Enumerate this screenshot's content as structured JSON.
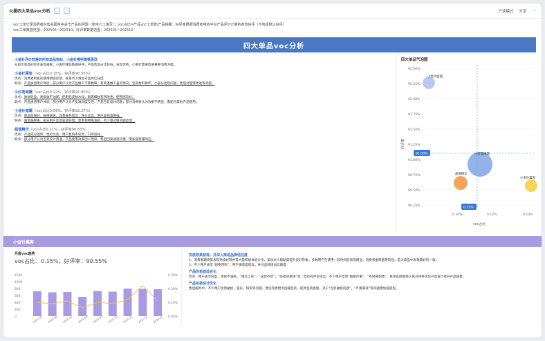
{
  "window": {
    "title": "火曼四大单品voc分析",
    "right_items": [
      "只读模式",
      "分享"
    ]
  },
  "meta": {
    "line1": "voc工单记录消费者在售后服务中关于产品的问题（使用人工填写）；voc占比=产品voc工单数/产品销量；好评率根据消费者电商平台产品评价计算的有效好评（不包括默认好评）",
    "line2": "voc工单数据范围：202505~202510；好评率数据范围：202501~202510"
  },
  "banner": {
    "title": "四大单品voc分析"
  },
  "left_text": {
    "heading": "小金针评价较差的所有单品指标，小金针哪些需要更改",
    "intro": "从四大单品的综合表现来看，小金针哪些数据好评，产品售后占比较低，表现优秀，小金针需要改进重要消费方面。",
    "products": [
      {
        "name": "小金针萬客",
        "stat": "（voc占比0.15%，好评率90.55%）",
        "pros_label": "优点：",
        "pros": "消费者积极的使用情感反馈，感受代入增加对品牌信任度",
        "cons_label": "缺点：",
        "cons": "产品质感用户体验，部分用户认为产品做工不够精细，有高温做工差的情况，包装材料易坏，小部分出现问题，售后处理需改进等问题。"
      },
      {
        "name": "小红笔眼霜",
        "stat": "（voc占比0.12%，好评率91.82%）",
        "pros_label": "优点：",
        "pros": "质地轻盈，易吸收不油腻，使用后皮肤水润，眼周细纹有所改善，使用感较好。",
        "cons_label": "缺点：",
        "cons": "产品质感用户体验，部分用户认为产品滋润度欠佳，产品包装设计问题，部分消费者认为效果不明显，需配合其他产品使用。"
      },
      {
        "name": "小金针面霜",
        "stat": "（voc占比0.09%，好评率92.27%）",
        "pros_label": "优点：",
        "pros": "保湿效果好，肤感清爽，改善肤色暗沉，性价比高，用户复购意愿强。",
        "cons_label": "缺点：",
        "cons": "质地偏厚重，部分用户反馈吸收较慢，夏季使用略油腻，有少量过敏问题反馈。"
      },
      {
        "name": "超值精华",
        "stat": "（voc占比0.11%，好评率90.83%）",
        "pros_label": "优点：",
        "pros": "产品成分温和，性价比高，用户复购率较高，口碑良好。",
        "cons_label": "缺点：",
        "cons": "部分用户认为包装设计普通，产品使用效果因人而异，售后回复速度较慢，需加强客服响应。"
      }
    ]
  },
  "bubble_chart": {
    "title": "四大单品气泡图",
    "x_label": "voc占比",
    "y_label": "好评率",
    "y_ticks": [
      "92.50%",
      "92.25%",
      "92.00%",
      "91.75%",
      "91.50%",
      "91.25%",
      "91.00%",
      "90.75%",
      "90.50%",
      "90.25%"
    ],
    "x_ticks": [
      "0.10%",
      "0.12%",
      "0.14%"
    ],
    "ref_y_label": "91.00%",
    "ref_x_label": "0.11%",
    "bubbles": [
      {
        "name": "小金针面霜",
        "color": "#b9c9ee"
      },
      {
        "name": "小红笔眼霜",
        "color": "#8aaae6"
      },
      {
        "name": "超值精华",
        "color": "#f3a55b"
      },
      {
        "name": "小金针萬客",
        "color": "#f7d35a"
      }
    ]
  },
  "section2": {
    "title": "小金针萬客"
  },
  "bottom_left": {
    "chart_title": "月度voc趋势",
    "stats": "voc占比：0.15%；好评率：90.55%",
    "y_left_ticks": [
      "1200",
      "1000",
      "800",
      "600",
      "400",
      "200",
      "0"
    ],
    "y_right_ticks": [
      "0.30%",
      "0.20%",
      "0.10%",
      "0.00%"
    ]
  },
  "chart_data": {
    "type": "bar",
    "categories": [
      "2025-05",
      "2025-06",
      "2025-07",
      "2025-08",
      "2025-09",
      "2025-10",
      "2025-11",
      "2025-12",
      "2026-01"
    ],
    "series": [
      {
        "values": [
          720,
          690,
          700,
          560,
          730,
          710,
          800,
          790,
          780
        ]
      },
      {
        "values": [
          0.1,
          0.09,
          0.11,
          0.06,
          0.1,
          0.09,
          0.12,
          0.22,
          0.11
        ]
      }
    ],
    "ylim": [
      0,
      1200
    ]
  },
  "bottom_right": {
    "h1": "优质效果获得，并深入推进品牌信任度",
    "p1": "1、消费者期待其表现持续好转并有大量积极体验分享，美妆达人帮助其提升良好形象，多数用户在使用一段时间后表现明显，消费者推荐意愿较强，是大单品中表现最好的一款。",
    "p2": "2、不少用户表示“想要回购”，用户满意度提高，并对品牌增加信赖度",
    "h2": "产品的表面适合化",
    "p3": "优点：用户表示轻盈，清爽不油腻，“相比之前”，“这款不错”，“吸收效果快”等，但也有评价指出，不少用户反馈“粘稠严重”，“有轻微刺激”，希望品牌能够认真对待并优化产品设计提升产品质量。",
    "h3": "产品包装设计优化",
    "p4": "售后服务中，不少用户反馈破损，变形，缺货等问题，建议完善物流运输包装，提高包装质量，对于“包装破损问题”，“严重漏液”等问题需加强管控。"
  }
}
